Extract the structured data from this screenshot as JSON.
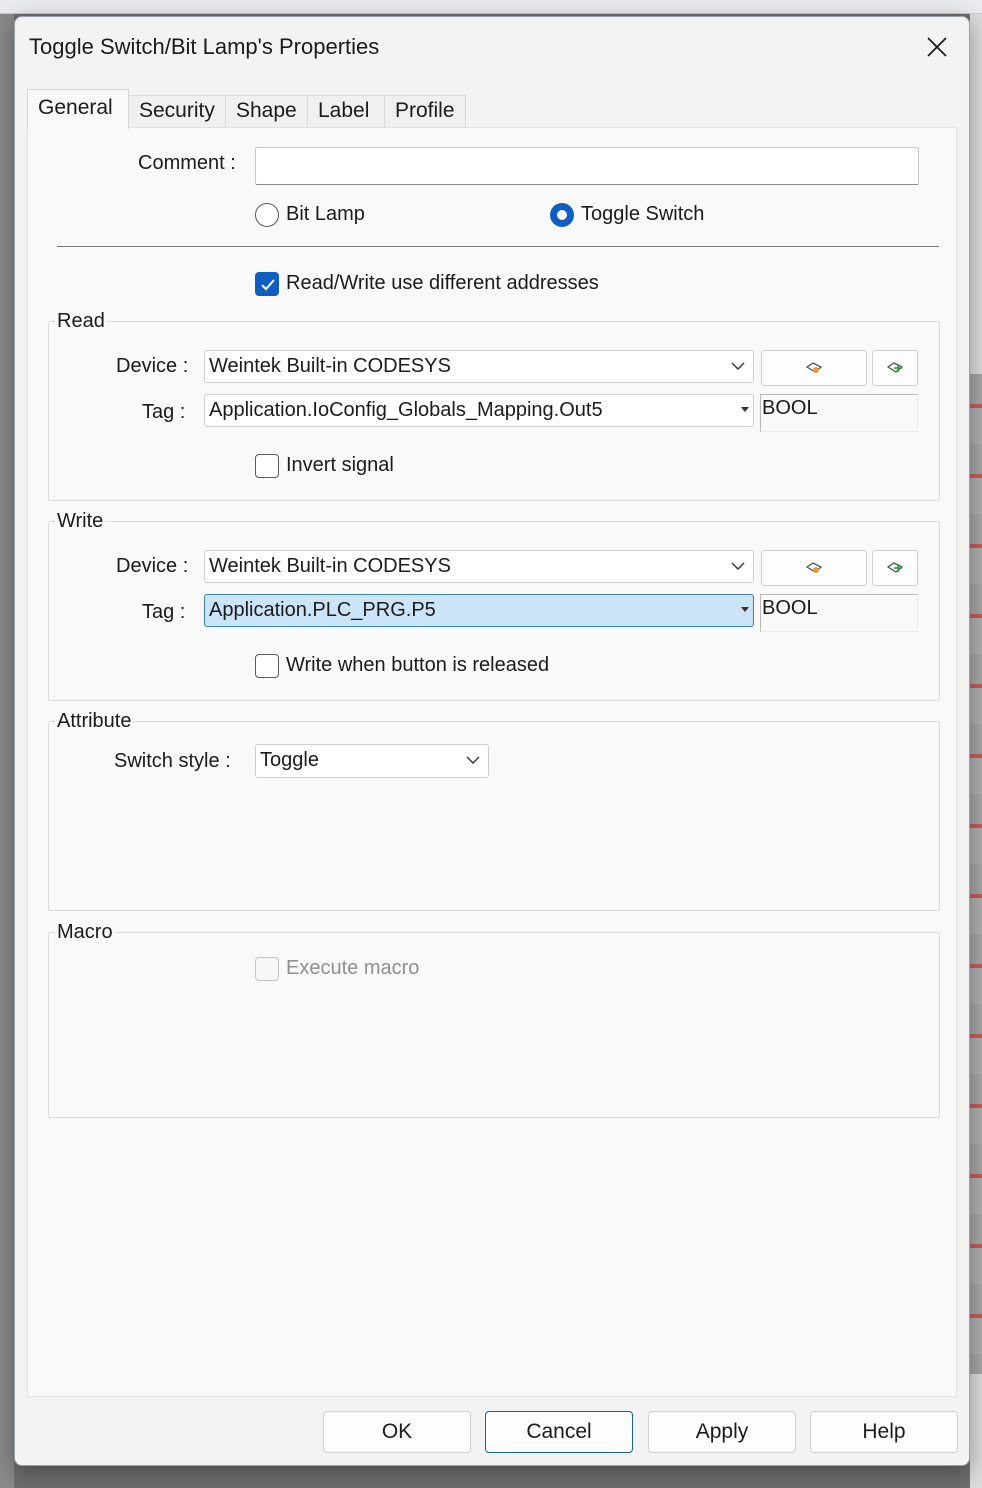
{
  "window": {
    "title": "Toggle Switch/Bit Lamp's Properties"
  },
  "tabs": [
    {
      "label": "General",
      "active": true
    },
    {
      "label": "Security",
      "active": false
    },
    {
      "label": "Shape",
      "active": false
    },
    {
      "label": "Label",
      "active": false
    },
    {
      "label": "Profile",
      "active": false
    }
  ],
  "general": {
    "comment_label": "Comment :",
    "comment_value": "",
    "mode_options": [
      {
        "label": "Bit Lamp",
        "selected": false
      },
      {
        "label": "Toggle Switch",
        "selected": true
      }
    ],
    "rw_diff_label": "Read/Write use different addresses",
    "rw_diff_checked": true
  },
  "read": {
    "title": "Read",
    "device_label": "Device :",
    "device_value": "Weintek Built-in CODESYS",
    "tag_label": "Tag :",
    "tag_value": "Application.IoConfig_Globals_Mapping.Out5",
    "type": "BOOL",
    "invert_label": "Invert signal",
    "invert_checked": false
  },
  "write": {
    "title": "Write",
    "device_label": "Device :",
    "device_value": "Weintek Built-in CODESYS",
    "tag_label": "Tag :",
    "tag_value": "Application.PLC_PRG.P5",
    "type": "BOOL",
    "released_label": "Write when button is released",
    "released_checked": false
  },
  "attribute": {
    "title": "Attribute",
    "switch_style_label": "Switch style :",
    "switch_style_value": "Toggle"
  },
  "macro": {
    "title": "Macro",
    "execute_label": "Execute macro",
    "execute_checked": false,
    "execute_enabled": false
  },
  "footer": {
    "ok": "OK",
    "cancel": "Cancel",
    "apply": "Apply",
    "help": "Help"
  },
  "colors": {
    "accent": "#0f5fc2",
    "selection": "#cce4f7",
    "dialog_bg": "#f3f3f3"
  },
  "icons": {
    "close": "close-icon",
    "device_settings": "device-settings-icon",
    "add_device": "add-device-icon",
    "dropdown": "chevron-down-icon",
    "checkmark": "checkmark-icon"
  }
}
